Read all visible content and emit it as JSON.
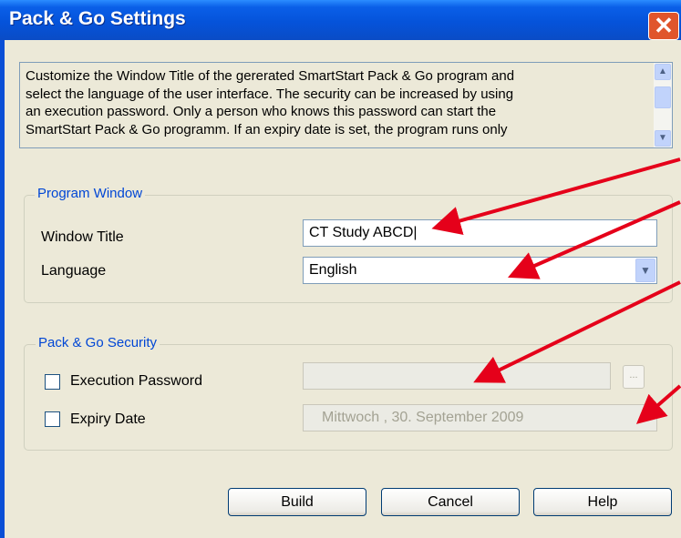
{
  "window": {
    "title": "Pack & Go Settings",
    "close_symbol": "✕"
  },
  "description": {
    "text": "Customize the Window Title of the gererated SmartStart Pack & Go program and\nselect the language of the user interface. The security can be increased by using\nan execution password. Only a person who knows this password can start the\nSmartStart Pack & Go programm. If an expiry date is set, the program runs only"
  },
  "program_window": {
    "group_label": "Program Window",
    "window_title_label": "Window Title",
    "window_title_value": "CT Study ABCD|",
    "language_label": "Language",
    "language_value": "English"
  },
  "security": {
    "group_label": "Pack & Go Security",
    "execution_password_label": "Execution Password",
    "execution_password_value": "",
    "ellipsis_label": "...",
    "expiry_date_label": "Expiry Date",
    "expiry_date_value": "Mittwoch  , 30. September 2009"
  },
  "buttons": {
    "build": "Build",
    "cancel": "Cancel",
    "help": "Help"
  },
  "icons": {
    "scroll_up": "scroll-up-icon",
    "scroll_down": "scroll-down-icon",
    "dropdown": "chevron-down-icon"
  },
  "colors": {
    "titlebar": "#0553da",
    "close_button": "#e0552c",
    "group_label": "#0046d5",
    "annotation_arrow": "#e5001a"
  }
}
